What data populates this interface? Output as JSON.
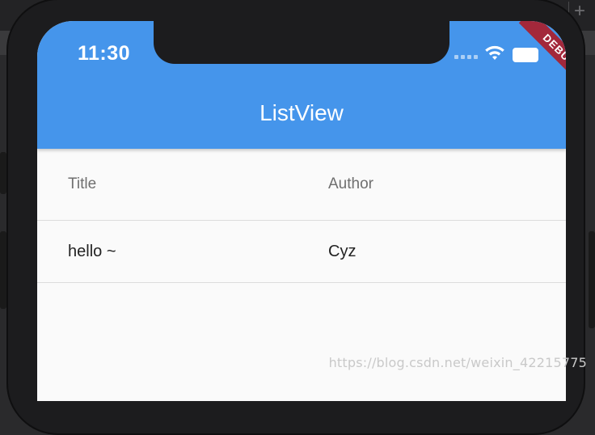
{
  "status_bar": {
    "time": "11:30"
  },
  "app_bar": {
    "title": "ListView",
    "debug_banner": "DEBUG"
  },
  "table": {
    "columns": [
      "Title",
      "Author"
    ],
    "rows": [
      [
        "hello ~",
        "Cyz"
      ]
    ]
  },
  "watermark": "https://blog.csdn.net/weixin_42215775",
  "colors": {
    "app_bar": "#4595eb",
    "debug_banner": "#a3283b",
    "background": "#fafafa"
  },
  "icons": [
    "signal-dots-icon",
    "wifi-icon",
    "battery-icon",
    "add-icon"
  ]
}
